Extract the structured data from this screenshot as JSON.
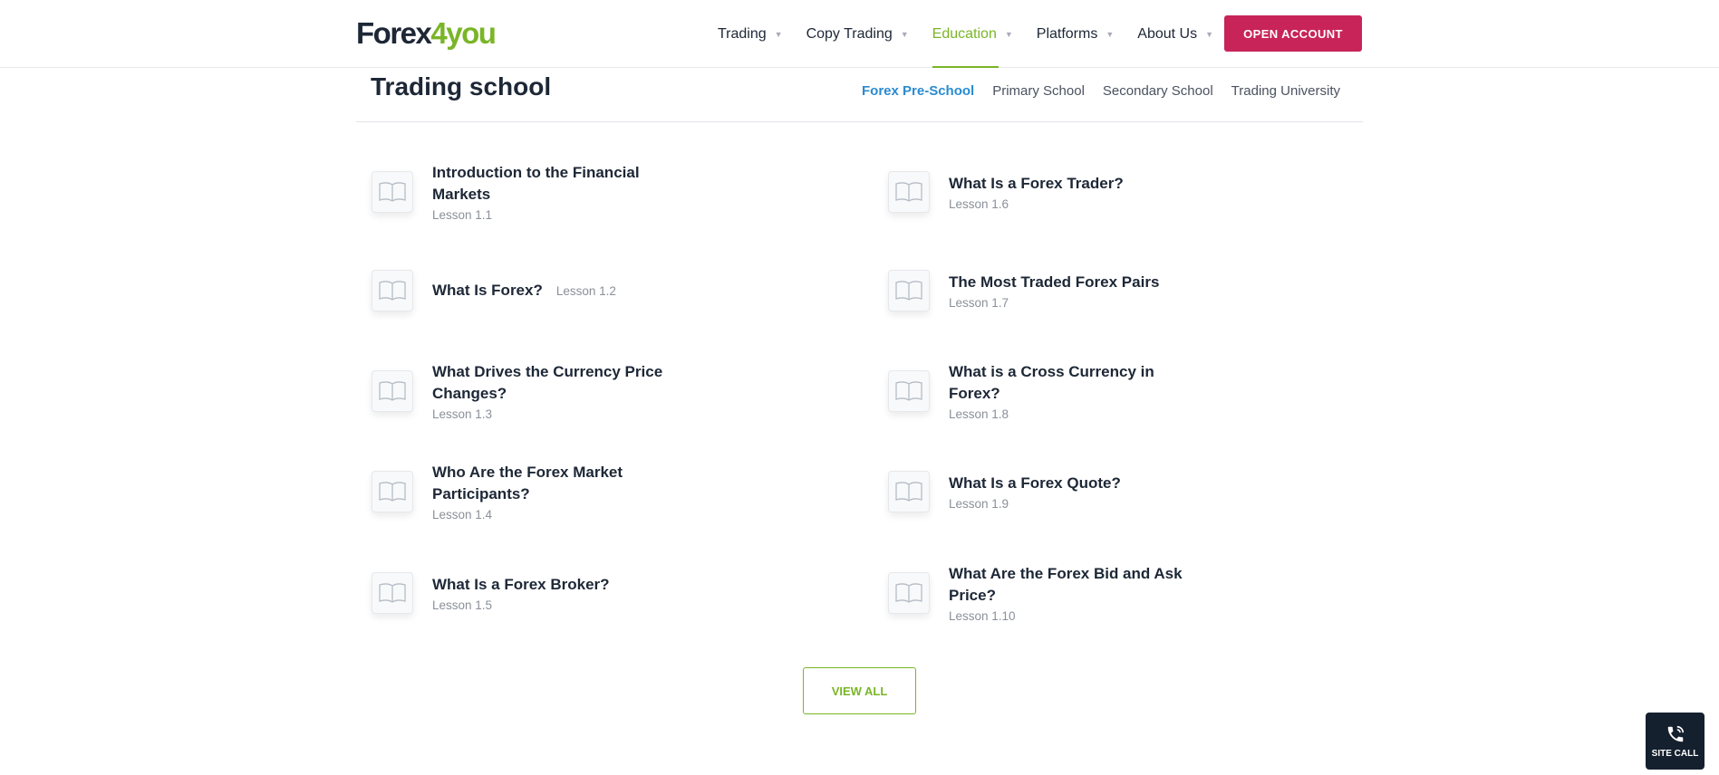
{
  "logo": {
    "part1": "Forex",
    "part2": "4you"
  },
  "nav": [
    {
      "label": "Trading"
    },
    {
      "label": "Copy Trading"
    },
    {
      "label": "Education",
      "active": true
    },
    {
      "label": "Platforms"
    },
    {
      "label": "About Us"
    }
  ],
  "open_account": "OPEN ACCOUNT",
  "page_title": "Trading school",
  "subnav": [
    {
      "label": "Forex Pre-School",
      "active": true
    },
    {
      "label": "Primary School"
    },
    {
      "label": "Secondary School"
    },
    {
      "label": "Trading University"
    }
  ],
  "lessons": [
    {
      "title": "Introduction to the Financial Markets",
      "lesson": "Lesson 1.1"
    },
    {
      "title": "What Is Forex?",
      "lesson": "Lesson 1.2"
    },
    {
      "title": "What Drives the Currency Price Changes?",
      "lesson": "Lesson 1.3"
    },
    {
      "title": "Who Are the Forex Market Participants?",
      "lesson": "Lesson 1.4"
    },
    {
      "title": "What Is a Forex Broker?",
      "lesson": "Lesson 1.5"
    },
    {
      "title": "What Is a Forex Trader?",
      "lesson": "Lesson 1.6"
    },
    {
      "title": "The Most Traded Forex Pairs",
      "lesson": "Lesson 1.7"
    },
    {
      "title": "What is a Cross Currency in Forex?",
      "lesson": "Lesson 1.8"
    },
    {
      "title": "What Is a Forex Quote?",
      "lesson": "Lesson 1.9"
    },
    {
      "title": "What Are the Forex Bid and Ask Price?",
      "lesson": "Lesson 1.10"
    }
  ],
  "view_all": "VIEW ALL",
  "site_call": "SITE CALL",
  "colors": {
    "brand_green": "#7ab527",
    "accent_red": "#c8245a",
    "link_blue": "#2a8bd0"
  }
}
